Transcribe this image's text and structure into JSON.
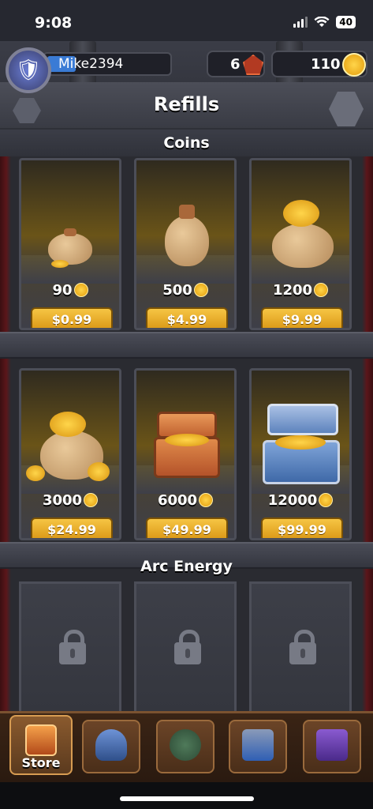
{
  "status_bar": {
    "time": "9:08",
    "battery": "40"
  },
  "header": {
    "username": "Mike2394",
    "gems": "6",
    "coins": "110",
    "title": "Refills"
  },
  "coins_section": {
    "title": "Coins",
    "items": [
      {
        "amount": "90",
        "price": "$0.99"
      },
      {
        "amount": "500",
        "price": "$4.99"
      },
      {
        "amount": "1200",
        "price": "$9.99"
      },
      {
        "amount": "3000",
        "price": "$24.99"
      },
      {
        "amount": "6000",
        "price": "$49.99"
      },
      {
        "amount": "12000",
        "price": "$99.99"
      }
    ]
  },
  "arc_energy_section": {
    "title": "Arc Energy",
    "locked_count": 3
  },
  "nav": {
    "store_label": "Store",
    "items": [
      "store-icon",
      "helmet-icon",
      "sword-icon",
      "shrine-icon",
      "chat-scroll-icon"
    ]
  },
  "colors": {
    "price_button": "#f6c544",
    "coin": "#ffd54a",
    "gem": "#b23a22"
  }
}
